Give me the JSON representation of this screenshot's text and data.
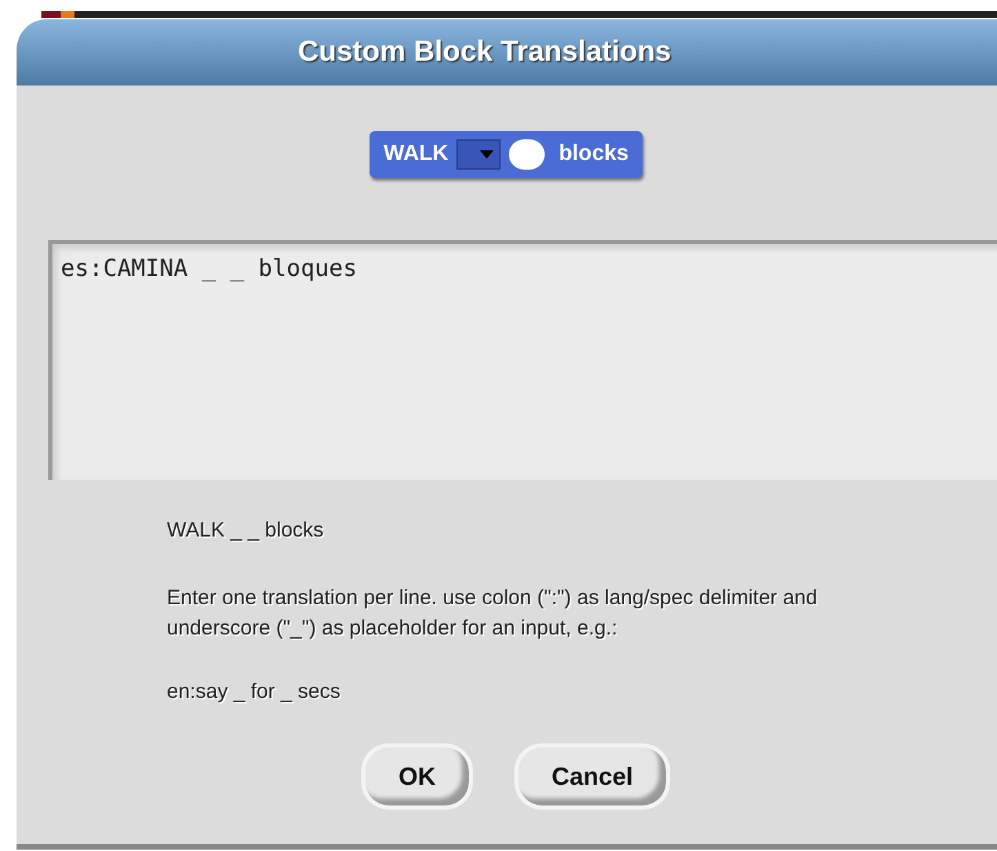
{
  "dialog": {
    "title": "Custom Block Translations",
    "block": {
      "label": "WALK",
      "suffix": "blocks"
    },
    "translations": {
      "value": "es:CAMINA _ _ bloques"
    },
    "spec": "WALK _ _ blocks",
    "help": "Enter one translation per line. use colon (\":\") as lang/spec delimiter and underscore (\"_\") as placeholder for an input, e.g.:",
    "example": "en:say _ for _ secs",
    "buttons": [
      "OK",
      "Cancel"
    ]
  }
}
